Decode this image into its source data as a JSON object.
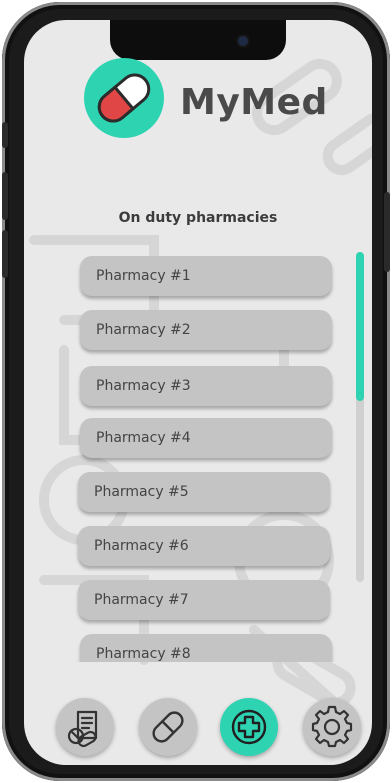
{
  "app": {
    "title": "MyMed"
  },
  "page": {
    "section_title": "On duty pharmacies"
  },
  "pharmacies": [
    {
      "label": "Pharmacy  #1"
    },
    {
      "label": "Pharmacy  #2"
    },
    {
      "label": "Pharmacy  #3"
    },
    {
      "label": "Pharmacy  #4"
    },
    {
      "label": "Pharmacy  #5"
    },
    {
      "label": "Pharmacy  #6"
    },
    {
      "label": "Pharmacy  #7"
    },
    {
      "label": "Pharmacy  #8"
    }
  ],
  "scroll": {
    "position": 0.0,
    "visible_fraction": 0.45
  },
  "bottom_nav": {
    "active": "pharmacies",
    "items": [
      {
        "id": "prescriptions",
        "icon": "prescription-pills-icon"
      },
      {
        "id": "medicines",
        "icon": "capsule-icon"
      },
      {
        "id": "pharmacies",
        "icon": "pharmacy-cross-icon"
      },
      {
        "id": "settings",
        "icon": "gear-icon"
      }
    ]
  },
  "colors": {
    "accent": "#2ed3b2",
    "pill_red": "#e04646",
    "screen_bg": "#e9e9e9",
    "item_bg": "#c4c4c4",
    "text": "#444444"
  }
}
